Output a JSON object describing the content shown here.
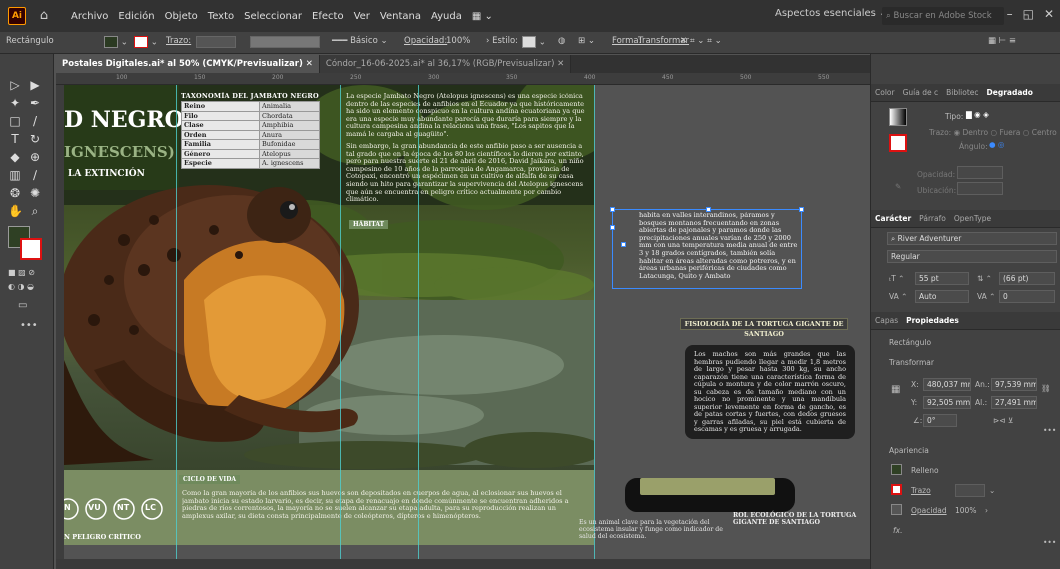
{
  "app": {
    "logo_text": "Ai",
    "menu": [
      "Archivo",
      "Edición",
      "Objeto",
      "Texto",
      "Seleccionar",
      "Efecto",
      "Ver",
      "Ventana",
      "Ayuda"
    ],
    "workspace": "Aspectos esenciales",
    "search_placeholder": "Buscar en Adobe Stock",
    "window_controls": [
      "–",
      "◱",
      "✕"
    ]
  },
  "controlbar": {
    "selection_type": "Rectángulo",
    "stroke_label": "Trazo:",
    "brush": "Básico",
    "opacity_label": "Opacidad:",
    "opacity_value": "100%",
    "style_label": "Estilo:",
    "shape_label": "Forma:",
    "transform_label": "Transformar"
  },
  "tabs": [
    {
      "label": "Postales Digitales.ai* al 50% (CMYK/Previsualizar)",
      "active": true
    },
    {
      "label": "Cóndor_16-06-2025.ai* al 36,17% (RGB/Previsualizar)",
      "active": false
    }
  ],
  "artboard": {
    "title_big": "D NEGRO",
    "title_sub": "IGNESCENS)",
    "extinction": "LA EXTINCIÓN",
    "taxonomy_title": "TAXONOMÍA DEL JAMBATO NEGRO",
    "taxonomy": [
      {
        "k": "Reino",
        "v": "Animalia"
      },
      {
        "k": "Filo",
        "v": "Chordata"
      },
      {
        "k": "Clase",
        "v": "Amphibia"
      },
      {
        "k": "Orden",
        "v": "Anura"
      },
      {
        "k": "Familia",
        "v": "Bufonidae"
      },
      {
        "k": "Género",
        "v": "Atelopus"
      },
      {
        "k": "Especie",
        "v": "A. ignescens"
      }
    ],
    "intro_text": "La especie Jambato Negro (Atelopus ignescens) es una especie icónica dentro de las especies de anfibios en el Ecuador ya que históricamente ha sido un elemento conspicuo en la cultura andina ecuatoriana ya que era una especie muy abundante parecía que duraría para siempre y la cultura campesina andina la relaciona una frase, \"Los sapitos que la mamá le cargaba al guagüito\".",
    "intro_text2": "Sin embargo, la gran abundancia de este anfibio paso a ser ausencia a tal grado que en la época de los 80 los científicos lo dieron por extinto, pero para nuestra suerte el 21 de abril de 2016, David Jaikara, un niño campesino de 10 años de la parroquia de Angamarca, provincia de Cotopaxi, encontró un espécimen en un cultivo de alfalfa de su casa siendo un hito para garantizar la supervivencia del Atelopus ignescens que aún se encuentra en peligro crítico actualmente por cambio climático.",
    "habitat_tag": "HÁBITAT",
    "ciclo_tag": "CICLO DE VIDA",
    "ciclo_text": "Como la gran mayoría de los anfibios sus huevos son depositados en cuerpos de agua, al eclosionar sus huevos el jambato inicia su estado larvario, es decir, su etapa de renacuajo en donde comúnmente se encuentran adheridos a piedras de ríos correntosos, la mayoría no se suelen alcanzar su etapa adulta, para su reproducción realizan un amplexus axilar, su dieta consta principalmente de coleópteros, dípteros e himenópteros.",
    "status_badges": [
      "N",
      "VU",
      "NT",
      "LC"
    ],
    "critico": "N PELIGRO CRÍTICO"
  },
  "canvas": {
    "habitat_text": "habita en valles interandinos, páramos y bosques montanos frecuentando en zonas abiertas de pajonales y paramos donde las precipitaciones anuales varían de 250 y 2000 mm con una temperatura media anual de entre 3 y 18 grados centígrados, también solía habitar en áreas alteradas como potreros, y en áreas urbanas periféricas de ciudades como Latacunga, Quito y Ambato",
    "tortuga_title": "FISIOLOGÍA DE LA TORTUGA GIGANTE DE SANTIAGO",
    "tortuga_text": "Los machos son más grandes que las hembras pudiendo llegar a medir 1,8 metros de largo y pesar hasta 300 kg, su ancho caparazón tiene una característica forma de cúpula o montura y de color marrón oscuro, su cabeza es de tamaño mediano con un hocico no prominente y una mandíbula superior levemente en forma de gancho, es de patas cortas y fuertes, con dedos gruesos y garras afiladas, su piel está cubierta de escamas y es gruesa y arrugada.",
    "rol_title": "ROL ECOLÓGICO DE LA TORTUGA GIGANTE DE SANTIAGO",
    "rol_text": "Es un animal clave para la vegetación del ecosistema insular y funge como indicador de salud del ecosistema."
  },
  "panels": {
    "top_tabs": [
      "Color",
      "Guía de c",
      "Bibliotec",
      "Degradado"
    ],
    "gradient_type_label": "Tipo:",
    "stroke_label": "Trazo:",
    "stroke_options": [
      "Dentro",
      "Fuera",
      "Centro"
    ],
    "angle_label": "Ángulo:",
    "opacity_label": "Opacidad:",
    "location_label": "Ubicación:",
    "char_tabs": [
      "Carácter",
      "Párrafo",
      "OpenType"
    ],
    "font_name": "River Adventurer",
    "font_style": "Regular",
    "font_size": "55 pt",
    "leading": "(66 pt)",
    "tracking_auto": "Auto",
    "kerning": "0",
    "props_tabs": [
      "Capas",
      "Propiedades"
    ],
    "shape_name": "Rectángulo",
    "transform_label": "Transformar",
    "x_label": "X:",
    "x_value": "480,037 mm",
    "y_label": "Y:",
    "y_value": "92,505 mm",
    "w_label": "An.:",
    "w_value": "97,539 mm",
    "h_label": "Al.:",
    "h_value": "27,491 mm",
    "angle_value": "0°",
    "appearance_label": "Apariencia",
    "fill_label": "Relleno",
    "stroke_label2": "Trazo",
    "opacity_label2": "Opacidad",
    "opacity_value2": "100%",
    "fx_label": "fx."
  },
  "ruler_ticks": [
    "100",
    "150",
    "200",
    "250",
    "300",
    "350",
    "400",
    "450",
    "500",
    "550"
  ]
}
